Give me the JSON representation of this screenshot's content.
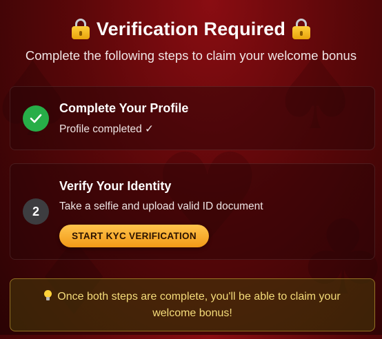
{
  "header": {
    "title": "Verification Required",
    "subtitle": "Complete the following steps to claim your welcome bonus"
  },
  "steps": [
    {
      "status": "completed",
      "title": "Complete Your Profile",
      "description": "Profile completed ✓",
      "badge_icon": "checkmark-icon"
    },
    {
      "status": "pending",
      "number": "2",
      "title": "Verify Your Identity",
      "description": "Take a selfie and upload valid ID document",
      "button_label": "START KYC VERIFICATION"
    }
  ],
  "notice": {
    "icon": "lightbulb-icon",
    "text": "Once both steps are complete, you'll be able to claim your welcome bonus!"
  },
  "colors": {
    "accent": "#f7a623",
    "success": "#27ae48",
    "background": "#5a0709",
    "notice_text": "#f5dc7a"
  }
}
